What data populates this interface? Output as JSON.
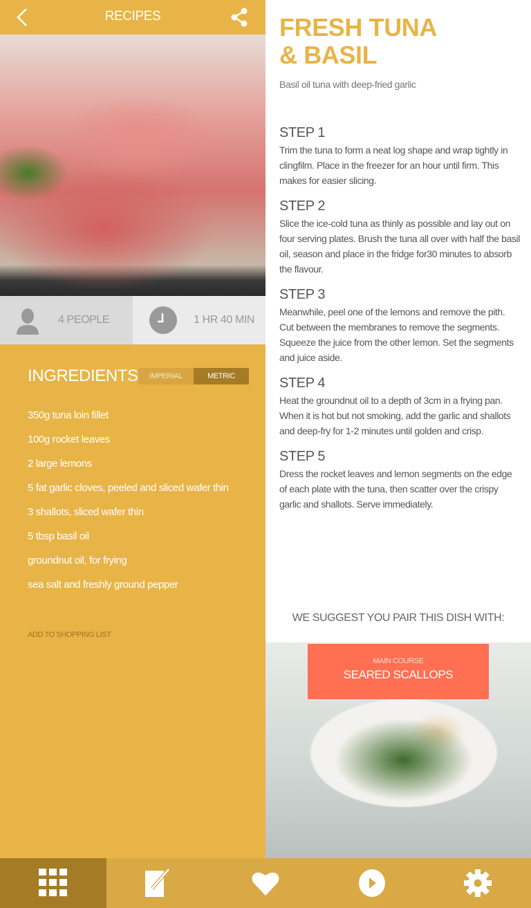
{
  "header": {
    "title": "RECIPES"
  },
  "stats": {
    "people": "4 PEOPLE",
    "time": "1 HR 40 MIN"
  },
  "ingredients": {
    "heading": "INGREDIENTS",
    "units": [
      "IMPERIAL",
      "METRIC"
    ],
    "selected_unit": "METRIC",
    "items": [
      "350g tuna loin fillet",
      "100g rocket leaves",
      "2 large lemons",
      "5 fat garlic cloves, peeled and sliced wafer thin",
      "3 shallots, sliced wafer thin",
      "5 tbsp basil oil",
      "groundnut oil, for frying",
      "sea salt and freshly ground pepper"
    ],
    "add_to_list": "ADD TO SHOPPING LIST"
  },
  "recipe": {
    "title_line1": "FRESH TUNA",
    "title_line2": "& BASIL",
    "subtitle": "Basil oil tuna with deep-fried garlic",
    "steps": [
      {
        "title": "STEP 1",
        "text": "Trim the tuna to form a neat log shape and wrap tightly in clingfilm. Place in the freezer for an  hour until firm. This makes for easier slicing."
      },
      {
        "title": "STEP 2",
        "text": "Slice the ice-cold tuna as thinly as possible and lay out on four serving plates. Brush the tuna all over with half the basil oil, season and place in the fridge for30 minutes to absorb the flavour."
      },
      {
        "title": "STEP 3",
        "text": "Meanwhile, peel one of the lemons and remove the pith. Cut between the membranes to remove the segments. Squeeze the juice from the other lemon. Set the segments and juice aside."
      },
      {
        "title": "STEP 4",
        "text": "Heat the groundnut oil to a depth of 3cm  in a frying pan. When it is hot but not smoking, add the garlic and shallots and deep-fry for 1-2 minutes until golden and crisp."
      },
      {
        "title": "STEP 5",
        "text": "Dress the rocket leaves and lemon segments on the edge of each plate with the tuna, then scatter over the crispy garlic and shallots. Serve immediately."
      }
    ]
  },
  "pairing": {
    "heading": "WE SUGGEST YOU PAIR THIS  DISH WITH:",
    "kind": "MAIN COURSE",
    "name": "SEARED SCALLOPS"
  },
  "nav": [
    "grid-icon",
    "notes-icon",
    "heart-icon",
    "play-icon",
    "gear-icon"
  ],
  "colors": {
    "accent": "#E8B447",
    "nav": "#D8A945",
    "active": "#A57C25",
    "coral": "#FF6F52"
  }
}
